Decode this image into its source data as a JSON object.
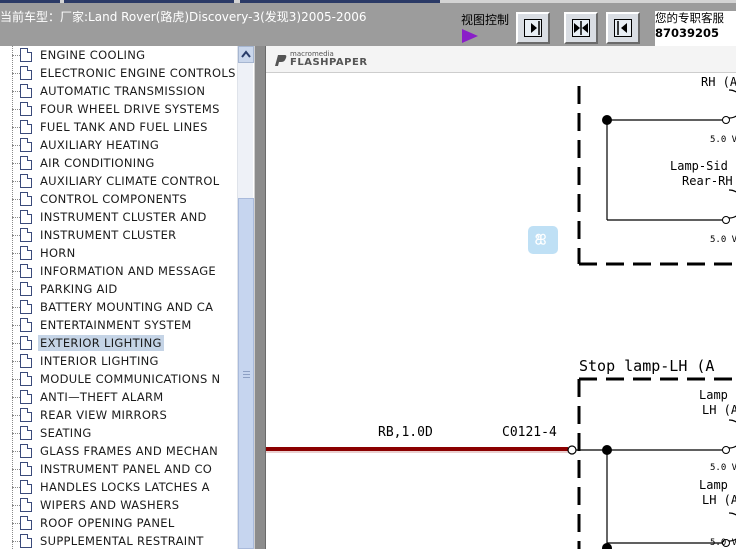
{
  "header": {
    "vehicle_title": "当前车型：厂家:Land Rover(路虎)Discovery-3(发现3)2005-2006",
    "view_control_label": "视图控制",
    "support_line1": "您的专职客服",
    "support_line2": "87039205"
  },
  "toolbar": {
    "buttons": [
      "expand-right",
      "split-center",
      "collapse-left"
    ]
  },
  "sidebar": {
    "items": [
      {
        "label": "ENGINE COOLING"
      },
      {
        "label": "ELECTRONIC ENGINE CONTROLS"
      },
      {
        "label": "AUTOMATIC TRANSMISSION"
      },
      {
        "label": "FOUR WHEEL DRIVE SYSTEMS"
      },
      {
        "label": "FUEL TANK AND FUEL LINES"
      },
      {
        "label": "AUXILIARY HEATING"
      },
      {
        "label": "AIR CONDITIONING"
      },
      {
        "label": "AUXILIARY CLIMATE CONTROL"
      },
      {
        "label": "CONTROL COMPONENTS"
      },
      {
        "label": "INSTRUMENT CLUSTER AND"
      },
      {
        "label": "INSTRUMENT CLUSTER"
      },
      {
        "label": "HORN"
      },
      {
        "label": "INFORMATION AND MESSAGE"
      },
      {
        "label": "PARKING AID"
      },
      {
        "label": "BATTERY MOUNTING AND CA"
      },
      {
        "label": "ENTERTAINMENT SYSTEM"
      },
      {
        "label": "EXTERIOR LIGHTING"
      },
      {
        "label": "INTERIOR LIGHTING"
      },
      {
        "label": "MODULE COMMUNICATIONS N"
      },
      {
        "label": "ANTI—THEFT ALARM"
      },
      {
        "label": "REAR VIEW MIRRORS"
      },
      {
        "label": "SEATING"
      },
      {
        "label": "GLASS FRAMES AND MECHAN"
      },
      {
        "label": "INSTRUMENT PANEL AND CO"
      },
      {
        "label": "HANDLES LOCKS LATCHES A"
      },
      {
        "label": "WIPERS AND WASHERS"
      },
      {
        "label": "ROOF OPENING PANEL"
      },
      {
        "label": "SUPPLEMENTAL RESTRAINT"
      }
    ],
    "selected_label": "EXTERIOR LIGHTING"
  },
  "viewer": {
    "brand_small": "macromedia",
    "brand_big": "FLASHPAPER",
    "diagram": {
      "top_label_rh": "RH (A",
      "voltage_1": "5.0 V",
      "lamp_side_rh_line1": "Lamp-Sid",
      "lamp_side_rh_line2": "Rear-RH",
      "voltage_2": "5.0 V",
      "stop_lamp_title": "Stop lamp-LH (A",
      "lamp_lh_1_line1": "Lamp",
      "lamp_lh_1_line2": "LH (A",
      "voltage_3": "5.0 V",
      "lamp_lh_2_line1": "Lamp",
      "lamp_lh_2_line2": "LH (A",
      "voltage_4": "5.0 V",
      "wire_label": "RB,1.0D",
      "connector_label": "C0121-4"
    }
  },
  "colors": {
    "topbar": "#9c9c9c",
    "selection": "#c5d4e6",
    "wire": "#8b0000",
    "play_icon": "#8a1ec8"
  }
}
